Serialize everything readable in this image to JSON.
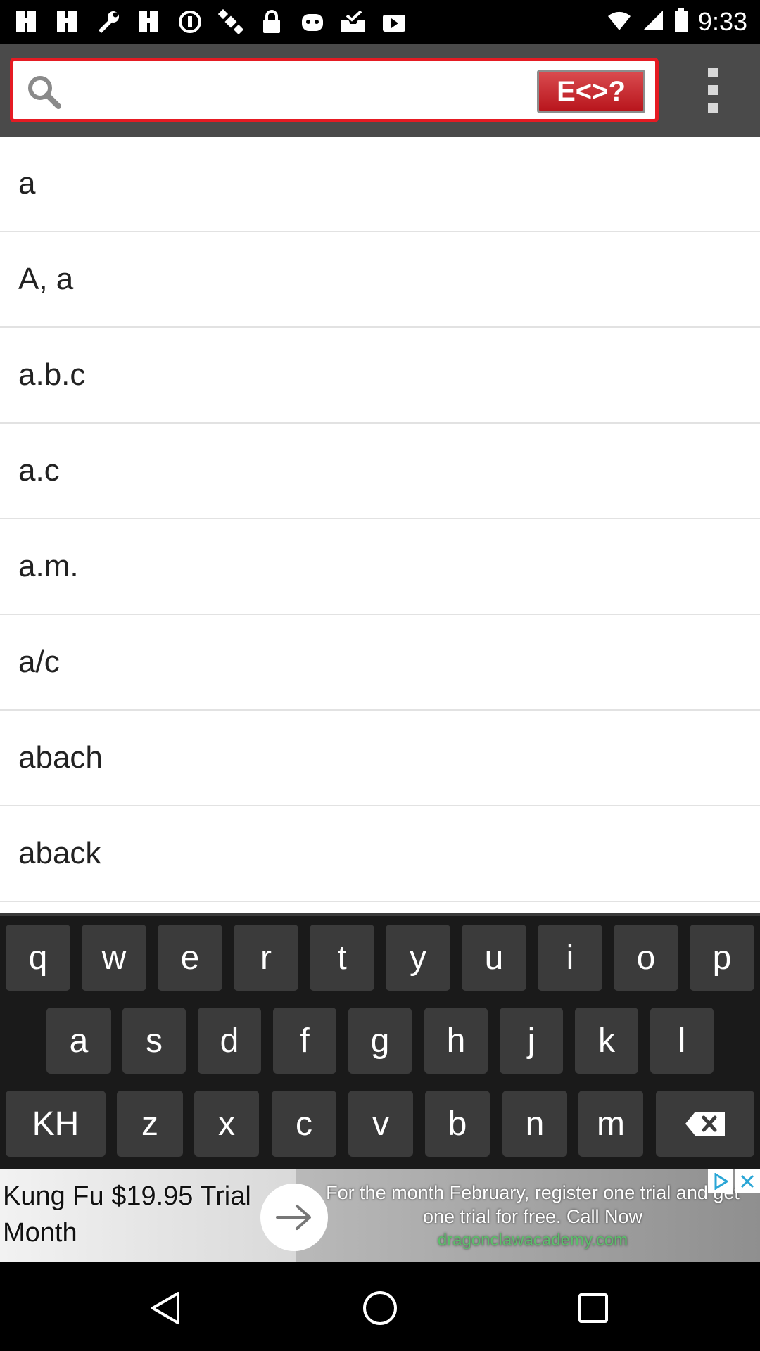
{
  "status_bar": {
    "time": "9:33",
    "left_icons": [
      "grid-icon",
      "grid-icon",
      "wrench-icon",
      "grid-icon",
      "circle-icon",
      "satellite-icon",
      "lock-icon",
      "android-icon",
      "inbox-icon",
      "play-store-icon"
    ]
  },
  "header": {
    "search_placeholder": "",
    "lang_button_label": "E<>?",
    "accent_color": "#e51b23"
  },
  "word_list": [
    "a",
    "A, a",
    "a.b.c",
    "a.c",
    "a.m.",
    "a/c",
    "abach",
    "aback"
  ],
  "keyboard": {
    "row1": [
      "q",
      "w",
      "e",
      "r",
      "t",
      "y",
      "u",
      "i",
      "o",
      "p"
    ],
    "row2": [
      "a",
      "s",
      "d",
      "f",
      "g",
      "h",
      "j",
      "k",
      "l"
    ],
    "row3_lang": "KH",
    "row3": [
      "z",
      "x",
      "c",
      "v",
      "b",
      "n",
      "m"
    ],
    "backspace_icon": "backspace-icon"
  },
  "ad": {
    "headline": "Kung Fu $19.95 Trial Month",
    "body": "For the month February, register one trial and get one trial for free. Call Now",
    "url": "dragonclawacademy.com"
  }
}
